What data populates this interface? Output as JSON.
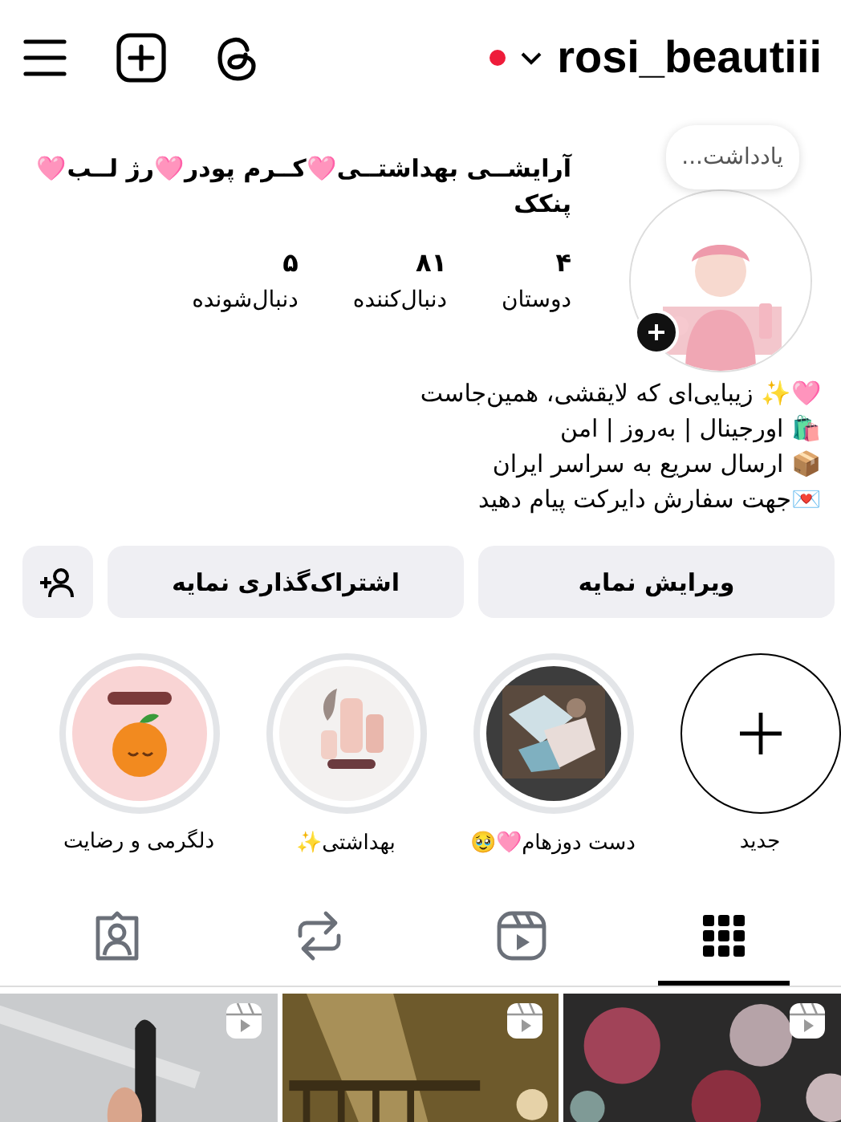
{
  "top_bar": {
    "username": "rosi_beautiii",
    "notification_dot": true
  },
  "profile": {
    "note": "یادداشت...",
    "name": "آرایشــی بهداشتــی🩷کــرم پودر🩷رژ لــب🩷 پنکک",
    "stats": [
      {
        "value": "۴",
        "label": "دوستان"
      },
      {
        "value": "۸۱",
        "label": "دنبال‌کننده"
      },
      {
        "value": "۵",
        "label": "دنبال‌شونده"
      }
    ],
    "bio": [
      "🩷✨ زیبایی‌ای که لایقشی، همین‌جاست",
      "🛍️ اورجینال | به‌روز | امن",
      "📦 ارسال سریع به سراسر ایران",
      "💌جهت سفارش دایرکت پیام دهید"
    ]
  },
  "buttons": [
    {
      "kind": "text",
      "label": "ویرایش نمایه"
    },
    {
      "kind": "text",
      "label": "اشتراک‌گذاری نمایه"
    },
    {
      "kind": "add-person"
    }
  ],
  "highlights": [
    {
      "kind": "new",
      "title": "جدید"
    },
    {
      "kind": "highlight",
      "title": "دست دوزهام🩷🥹"
    },
    {
      "kind": "highlight",
      "title": "بهداشتی✨"
    },
    {
      "kind": "highlight",
      "title": "دلگرمی و رضایت"
    }
  ],
  "tabs": [
    {
      "kind": "grid",
      "selected": true
    },
    {
      "kind": "reels",
      "selected": false
    },
    {
      "kind": "reposts",
      "selected": false
    },
    {
      "kind": "tagged",
      "selected": false
    }
  ],
  "posts": [
    {
      "kind": "reel"
    },
    {
      "kind": "reel"
    },
    {
      "kind": "reel"
    }
  ]
}
